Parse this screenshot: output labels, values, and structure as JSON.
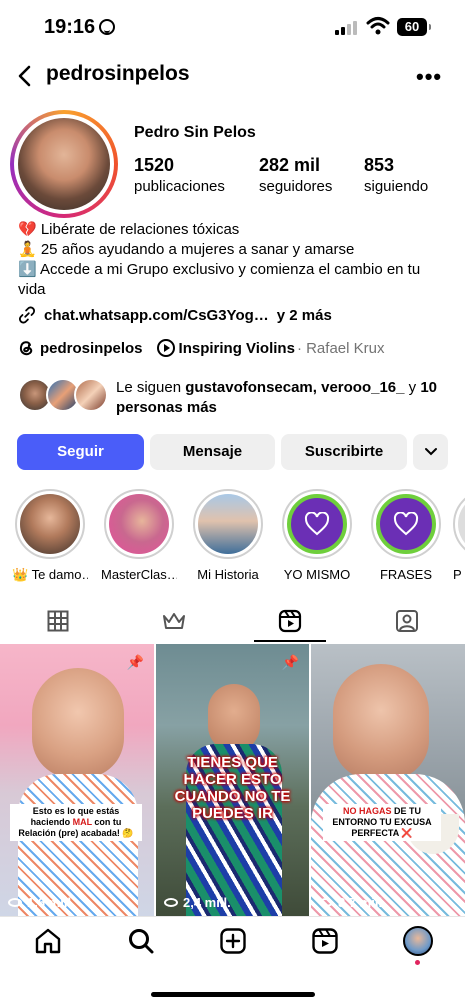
{
  "status": {
    "time": "19:16",
    "battery": "60"
  },
  "header": {
    "username": "pedrosinpelos",
    "more_label": "•••"
  },
  "profile": {
    "display_name": "Pedro Sin Pelos",
    "stats": [
      {
        "value": "1520",
        "label": "publicaciones"
      },
      {
        "value": "282 mil",
        "label": "seguidores"
      },
      {
        "value": "853",
        "label": "siguiendo"
      }
    ],
    "bio": [
      "💔 Libérate de relaciones tóxicas",
      "🧘 25 años ayudando a mujeres a sanar y amarse",
      "⬇️ Accede a mi Grupo exclusivo y comienza el cambio en tu vida"
    ],
    "link": "chat.whatsapp.com/CsG3Yog…",
    "link_more": "y 2 más",
    "threads_handle": "pedrosinpelos",
    "music_title": "Inspiring Violins",
    "music_artist": "· Rafael Krux",
    "followed_by_prefix": "Le siguen ",
    "followed_by_names": "gustavofonsecam, verooo_16_",
    "followed_by_join": " y ",
    "followed_by_rest": "10 personas más"
  },
  "buttons": {
    "follow": "Seguir",
    "message": "Mensaje",
    "subscribe": "Suscribirte"
  },
  "highlights": [
    {
      "label": "👑 Te damo…"
    },
    {
      "label": "MasterClas…"
    },
    {
      "label": "Mi Historia"
    },
    {
      "label": "YO MISMO"
    },
    {
      "label": "FRASES"
    },
    {
      "label": "P"
    }
  ],
  "reels": [
    {
      "views": "1,6 mill.",
      "caption_a": "Esto es lo que estás haciendo ",
      "caption_b": "MAL",
      "caption_c": " con tu Relación (pre) acabada! 🤔",
      "pinned": true
    },
    {
      "views": "2,4 mill.",
      "caption": "TIENES QUE HACER ESTO CUANDO NO TE PUEDES IR",
      "pinned": true
    },
    {
      "views": "3,7 mill.",
      "caption_a": "NO HAGAS",
      "caption_b": " DE TU ENTORNO TU EXCUSA PERFECTA ❌",
      "pinned": false
    }
  ],
  "colors": {
    "primary_button": "#4a5df9",
    "accent_red": "#e0245e"
  }
}
